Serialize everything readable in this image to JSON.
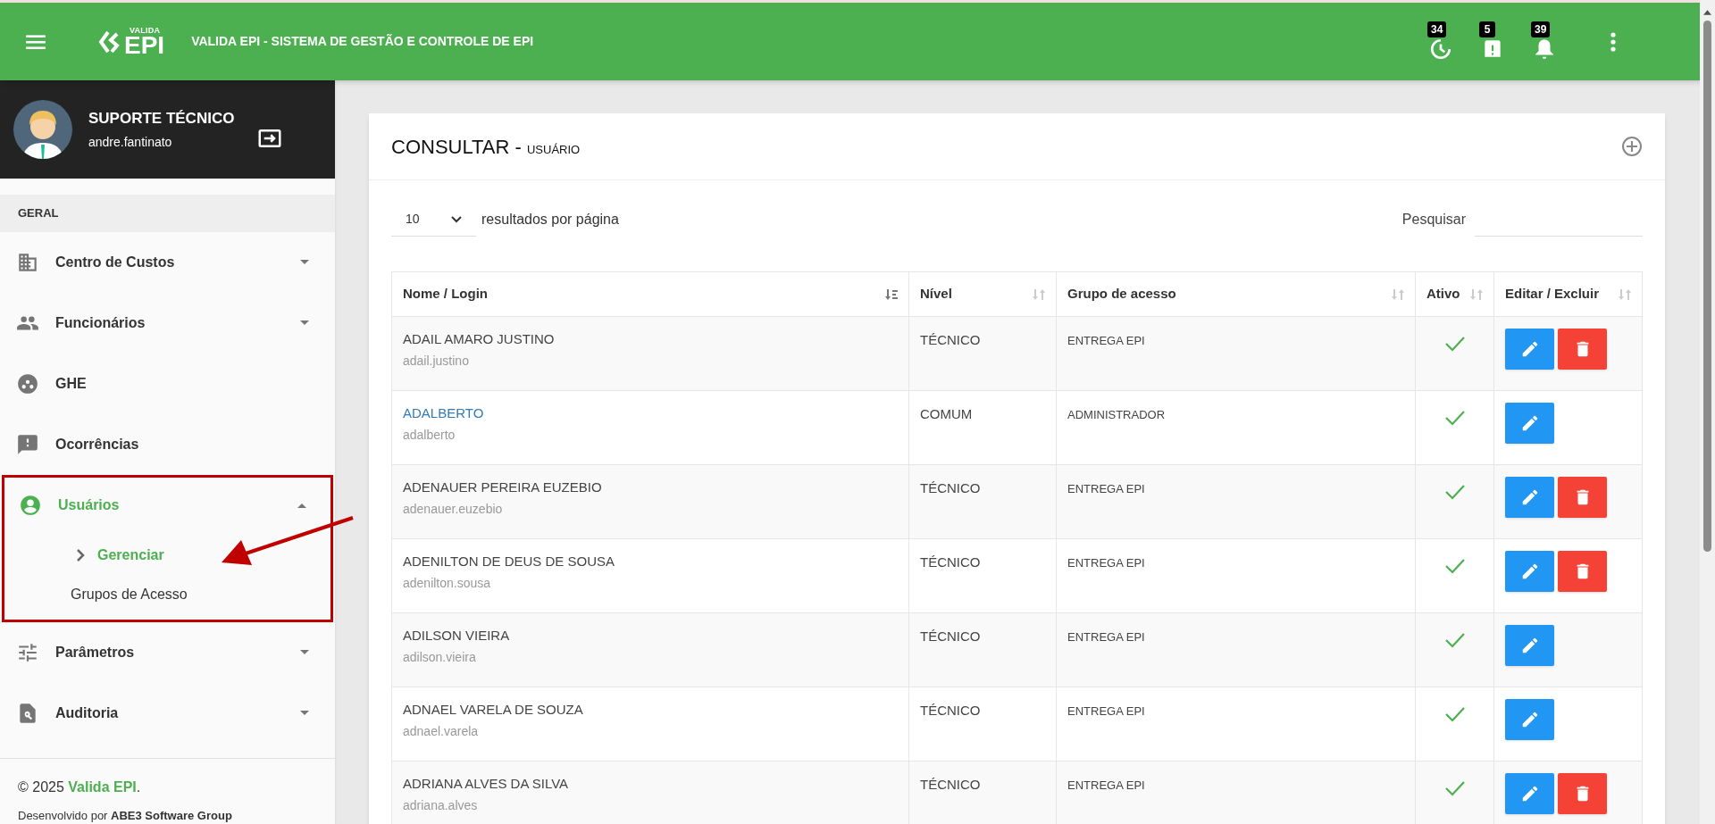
{
  "app_bar": {
    "logo_small": "VALIDA",
    "logo_large": "EPI",
    "title": "VALIDA EPI - SISTEMA DE GESTÃO E CONTROLE DE EPI",
    "badges": [
      {
        "kind": "clock",
        "count": "34"
      },
      {
        "kind": "alert",
        "count": "5"
      },
      {
        "kind": "bell",
        "count": "39"
      }
    ]
  },
  "profile": {
    "role": "SUPORTE TÉCNICO",
    "login": "andre.fantinato"
  },
  "sidebar": {
    "section": "GERAL",
    "items": [
      {
        "kind": "building",
        "label": "Centro de Custos",
        "expanded": false,
        "has_caret": true,
        "selected": false
      },
      {
        "kind": "people",
        "label": "Funcionários",
        "expanded": false,
        "has_caret": true,
        "selected": false
      },
      {
        "kind": "group",
        "label": "GHE",
        "has_caret": false,
        "selected": false
      },
      {
        "kind": "feedback",
        "label": "Ocorrências",
        "has_caret": false,
        "selected": false
      },
      {
        "kind": "user",
        "label": "Usuários",
        "expanded": true,
        "has_caret": true,
        "selected": true,
        "children": [
          {
            "label": "Gerenciar",
            "selected": true
          },
          {
            "label": "Grupos de Acesso",
            "selected": false
          }
        ]
      },
      {
        "kind": "tune",
        "label": "Parâmetros",
        "expanded": false,
        "has_caret": true,
        "selected": false
      },
      {
        "kind": "search-doc",
        "label": "Auditoria",
        "expanded": false,
        "has_caret": true,
        "selected": false
      }
    ],
    "footer_prefix": "© 2025 ",
    "footer_brand": "Valida EPI",
    "footer_suffix": ".",
    "developer": "Desenvolvido por **ABE3 Software Group**"
  },
  "card": {
    "title": "CONSULTAR - ",
    "subtitle": "USUÁRIO",
    "page_size": "10",
    "page_size_label": "resultados por página",
    "search_label": "Pesquisar",
    "table": {
      "columns": [
        {
          "label": "Nome / Login",
          "sorted": true
        },
        {
          "label": "Nível",
          "sorted": false
        },
        {
          "label": "Grupo de acesso",
          "sorted": false
        },
        {
          "label": "Ativo",
          "sorted": false
        },
        {
          "label": "Editar / Excluir",
          "sorted": false
        }
      ],
      "rows": [
        {
          "name": "ADAIL AMARO JUSTINO",
          "login": "adail.justino",
          "level": "TÉCNICO",
          "group": "ENTREGA EPI",
          "active": true,
          "deletable": true,
          "highlighted": false
        },
        {
          "name": "ADALBERTO",
          "login": "adalberto",
          "level": "COMUM",
          "group": "ADMINISTRADOR",
          "active": true,
          "deletable": false,
          "highlighted": true
        },
        {
          "name": "ADENAUER PEREIRA EUZEBIO",
          "login": "adenauer.euzebio",
          "level": "TÉCNICO",
          "group": "ENTREGA EPI",
          "active": true,
          "deletable": true,
          "highlighted": false
        },
        {
          "name": "ADENILTON DE DEUS DE SOUSA",
          "login": "adenilton.sousa",
          "level": "TÉCNICO",
          "group": "ENTREGA EPI",
          "active": true,
          "deletable": true,
          "highlighted": false
        },
        {
          "name": "ADILSON VIEIRA",
          "login": "adilson.vieira",
          "level": "TÉCNICO",
          "group": "ENTREGA EPI",
          "active": true,
          "deletable": false,
          "highlighted": false
        },
        {
          "name": "ADNAEL VARELA DE SOUZA",
          "login": "adnael.varela",
          "level": "TÉCNICO",
          "group": "ENTREGA EPI",
          "active": true,
          "deletable": false,
          "highlighted": false
        },
        {
          "name": "ADRIANA ALVES DA SILVA",
          "login": "adriana.alves",
          "level": "TÉCNICO",
          "group": "ENTREGA EPI",
          "active": true,
          "deletable": true,
          "highlighted": false
        }
      ]
    }
  }
}
